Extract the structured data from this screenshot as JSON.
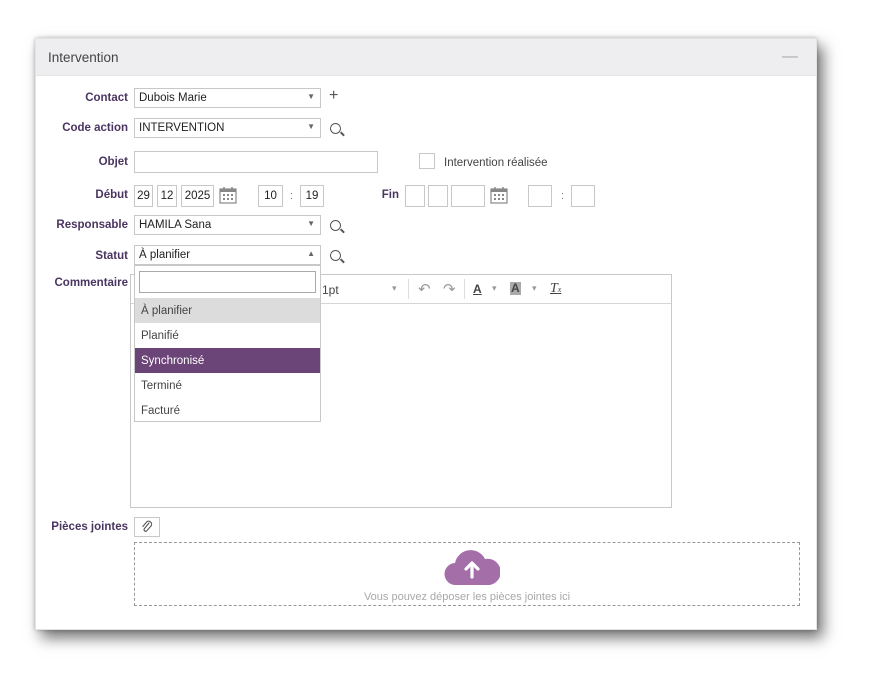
{
  "panel": {
    "title": "Intervention",
    "collapse_symbol": "—"
  },
  "form": {
    "contact": {
      "label": "Contact",
      "value": "Dubois Marie",
      "add_symbol": "+"
    },
    "code_action": {
      "label": "Code action",
      "value": "INTERVENTION"
    },
    "objet": {
      "label": "Objet",
      "value": ""
    },
    "intervention_realisee": {
      "label": "Intervention réalisée",
      "checked": false
    },
    "debut": {
      "label": "Début",
      "day": "29",
      "month": "12",
      "year": "2025",
      "hour": "10",
      "minute": "19",
      "colon": ":"
    },
    "fin": {
      "label": "Fin",
      "day": "",
      "month": "",
      "year": "",
      "hour": "",
      "minute": "",
      "colon": ":"
    },
    "responsable": {
      "label": "Responsable",
      "value": "HAMILA Sana"
    },
    "statut": {
      "label": "Statut",
      "value": "À planifier"
    },
    "commentaire": {
      "label": "Commentaire"
    },
    "pieces_jointes": {
      "label": "Pièces jointes"
    }
  },
  "editor_toolbar": {
    "font_size": "1pt",
    "undo": "↶",
    "redo": "↷",
    "text_color": "A",
    "bg_color": "A",
    "clear_format": "T",
    "clear_sub": "x",
    "caret": "▾"
  },
  "statut_dropdown": {
    "search_value": "",
    "options": [
      "À planifier",
      "Planifié",
      "Synchronisé",
      "Terminé",
      "Facturé"
    ],
    "hovered": "À planifier",
    "highlighted": "Synchronisé"
  },
  "dropzone": {
    "text": "Vous pouvez déposer les pièces jointes ici"
  },
  "colors": {
    "accent": "#6b4478",
    "label": "#4a3560",
    "cloud": "#a46fa8"
  }
}
